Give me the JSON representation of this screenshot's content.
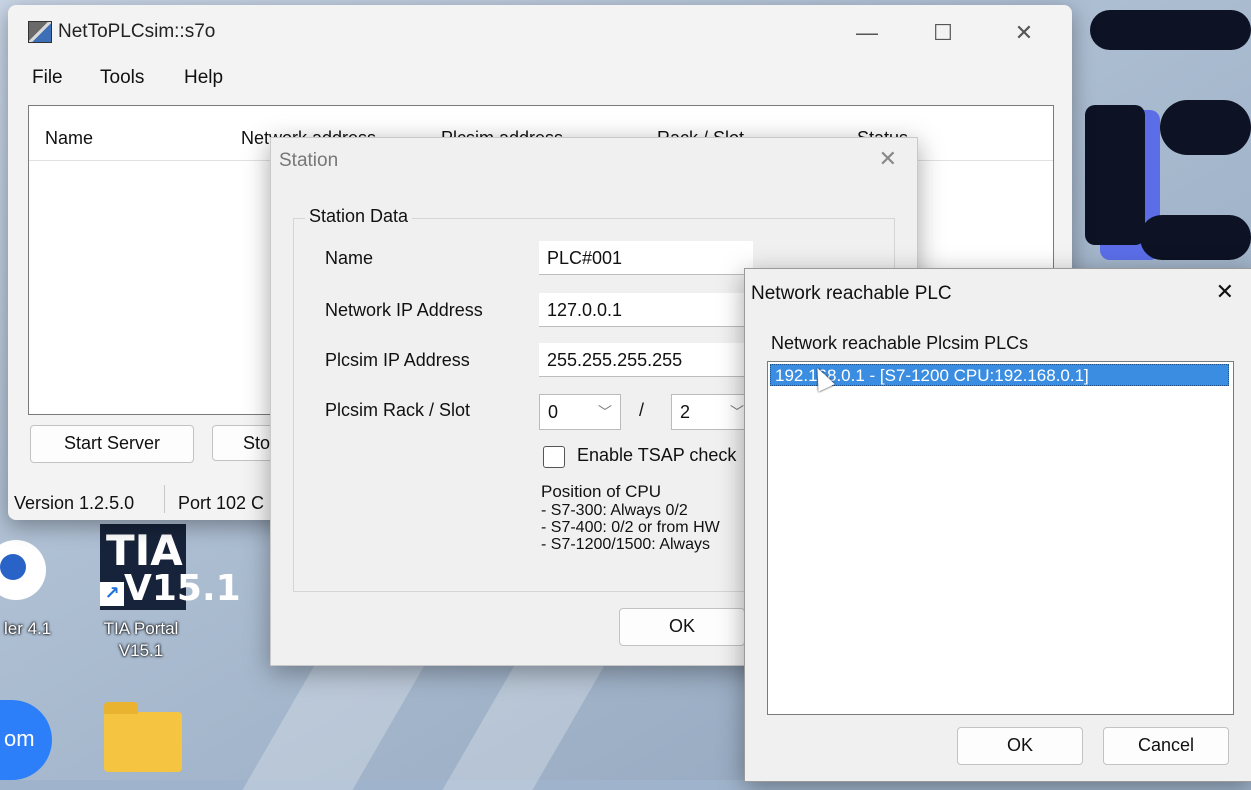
{
  "desktop": {
    "icons": [
      {
        "label": "ler 4.1"
      },
      {
        "label": "TIA Portal V15.1",
        "line1": "TIA Portal",
        "line2": "V15.1",
        "badge": "TIA",
        "version": "V15.1"
      },
      {
        "label": "om"
      }
    ]
  },
  "main_window": {
    "title": "NetToPLCsim::s7o",
    "menu": [
      "File",
      "Tools",
      "Help"
    ],
    "columns": [
      "Name",
      "Network address",
      "Plcsim address",
      "Rack / Slot",
      "Status"
    ],
    "buttons": {
      "start": "Start Server",
      "stop": "Sto"
    },
    "status": {
      "version": "Version 1.2.5.0",
      "port": "Port 102 C"
    }
  },
  "station_dialog": {
    "title": "Station",
    "group": "Station Data",
    "labels": {
      "name": "Name",
      "network_ip": "Network IP Address",
      "plcsim_ip": "Plcsim IP Address",
      "rack_slot": "Plcsim Rack / Slot"
    },
    "values": {
      "name": "PLC#001",
      "network_ip": "127.0.0.1",
      "plcsim_ip": "255.255.255.255",
      "rack": "0",
      "slot": "2",
      "slash": "/"
    },
    "tsap_label": "Enable TSAP check",
    "tsap_checked": false,
    "cpu_info": {
      "heading": "Position of CPU",
      "lines": [
        "- S7-300: Always 0/2",
        "- S7-400: 0/2 or from HW",
        "- S7-1200/1500: Always"
      ]
    },
    "ok": "OK"
  },
  "reach_dialog": {
    "title": "Network reachable PLC",
    "list_label": "Network reachable Plcsim PLCs",
    "items": [
      "192.168.0.1 - [S7-1200 CPU:192.168.0.1]"
    ],
    "ok": "OK",
    "cancel": "Cancel"
  },
  "colors": {
    "selection": "#3a8de0",
    "desktop_dark": "#0d1224",
    "desktop_accent": "#5b6ee8"
  }
}
